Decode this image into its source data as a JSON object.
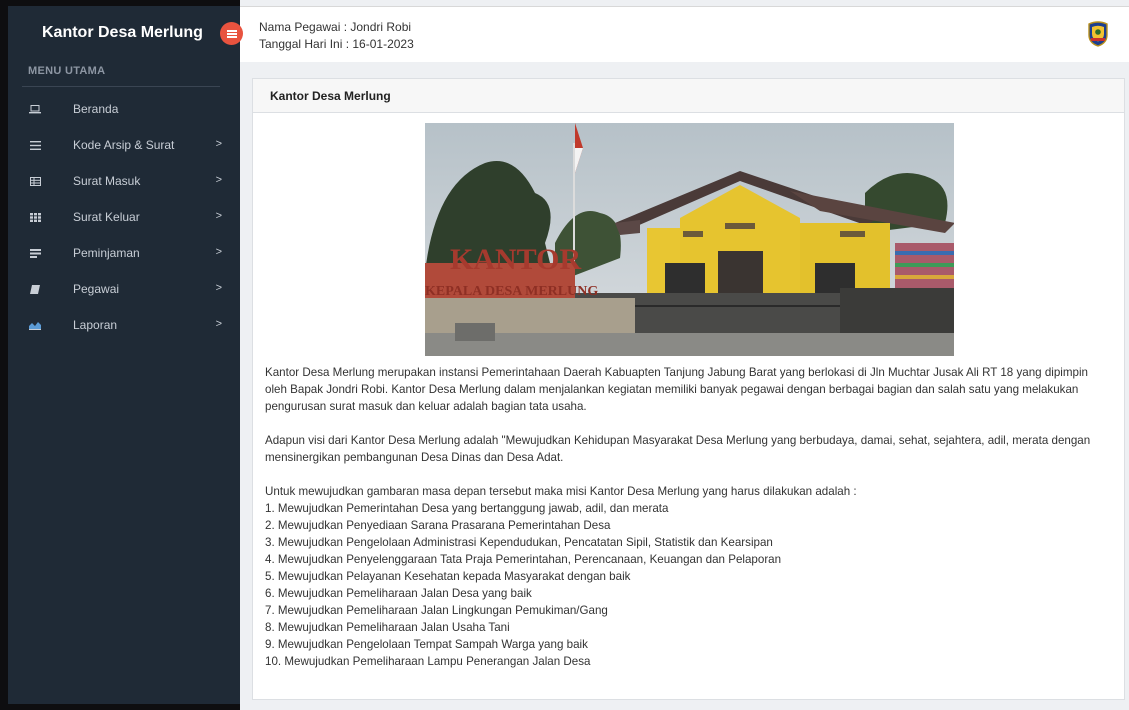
{
  "sidebar": {
    "brand": "Kantor Desa Merlung",
    "menu_header": "MENU UTAMA",
    "items": [
      {
        "label": "Beranda",
        "icon": "laptop-icon",
        "has_arrow": false
      },
      {
        "label": "Kode Arsip & Surat",
        "icon": "bars-icon",
        "has_arrow": true
      },
      {
        "label": "Surat Masuk",
        "icon": "table-icon",
        "has_arrow": true
      },
      {
        "label": "Surat Keluar",
        "icon": "grid-icon",
        "has_arrow": true
      },
      {
        "label": "Peminjaman",
        "icon": "list-icon",
        "has_arrow": true
      },
      {
        "label": "Pegawai",
        "icon": "book-icon",
        "has_arrow": true
      },
      {
        "label": "Laporan",
        "icon": "chart-icon",
        "has_arrow": true
      }
    ],
    "arrow": ">"
  },
  "topbar": {
    "employee": "Nama Pegawai : Jondri Robi",
    "date": "Tanggal Hari Ini : 16-01-2023"
  },
  "card": {
    "title": "Kantor Desa Merlung",
    "photo_sign": "KANTOR",
    "photo_sign_sub": "KEPALA DESA MERLUNG",
    "paragraph1": "Kantor Desa Merlung merupakan instansi Pemerintahaan Daerah Kabuapten Tanjung Jabung Barat yang berlokasi di Jln Muchtar Jusak Ali RT 18 yang dipimpin oleh Bapak Jondri Robi. Kantor Desa Merlung dalam menjalankan kegiatan memiliki banyak pegawai dengan berbagai bagian dan salah satu yang melakukan pengurusan surat masuk dan keluar adalah bagian tata usaha.",
    "paragraph2": "Adapun visi dari Kantor Desa Merlung adalah \"Mewujudkan Kehidupan Masyarakat Desa Merlung yang berbudaya, damai, sehat, sejahtera, adil, merata dengan mensinergikan pembangunan Desa Dinas dan Desa Adat.",
    "mission_intro": "Untuk mewujudkan gambaran masa depan tersebut maka misi Kantor Desa Merlung yang harus dilakukan adalah :",
    "missions": [
      "1. Mewujudkan Pemerintahan Desa yang bertanggung jawab, adil, dan merata",
      "2. Mewujudkan Penyediaan Sarana Prasarana Pemerintahan Desa",
      "3. Mewujudkan Pengelolaan Administrasi Kependudukan, Pencatatan Sipil, Statistik dan Kearsipan",
      "4. Mewujudkan Penyelenggaraan Tata Praja Pemerintahan, Perencanaan, Keuangan dan Pelaporan",
      "5. Mewujudkan Pelayanan Kesehatan kepada Masyarakat dengan baik",
      "6. Mewujudkan Pemeliharaan Jalan Desa yang baik",
      "7. Mewujudkan Pemeliharaan Jalan Lingkungan Pemukiman/Gang",
      "8. Mewujudkan Pemeliharaan Jalan Usaha Tani",
      "9. Mewujudkan Pengelolaan Tempat Sampah Warga yang baik",
      "10. Mewujudkan Pemeliharaan Lampu Penerangan Jalan Desa"
    ]
  },
  "colors": {
    "sidebar_bg": "#1f2a36",
    "toggle_accent": "#e8533f",
    "page_bg": "#eef0f3"
  }
}
